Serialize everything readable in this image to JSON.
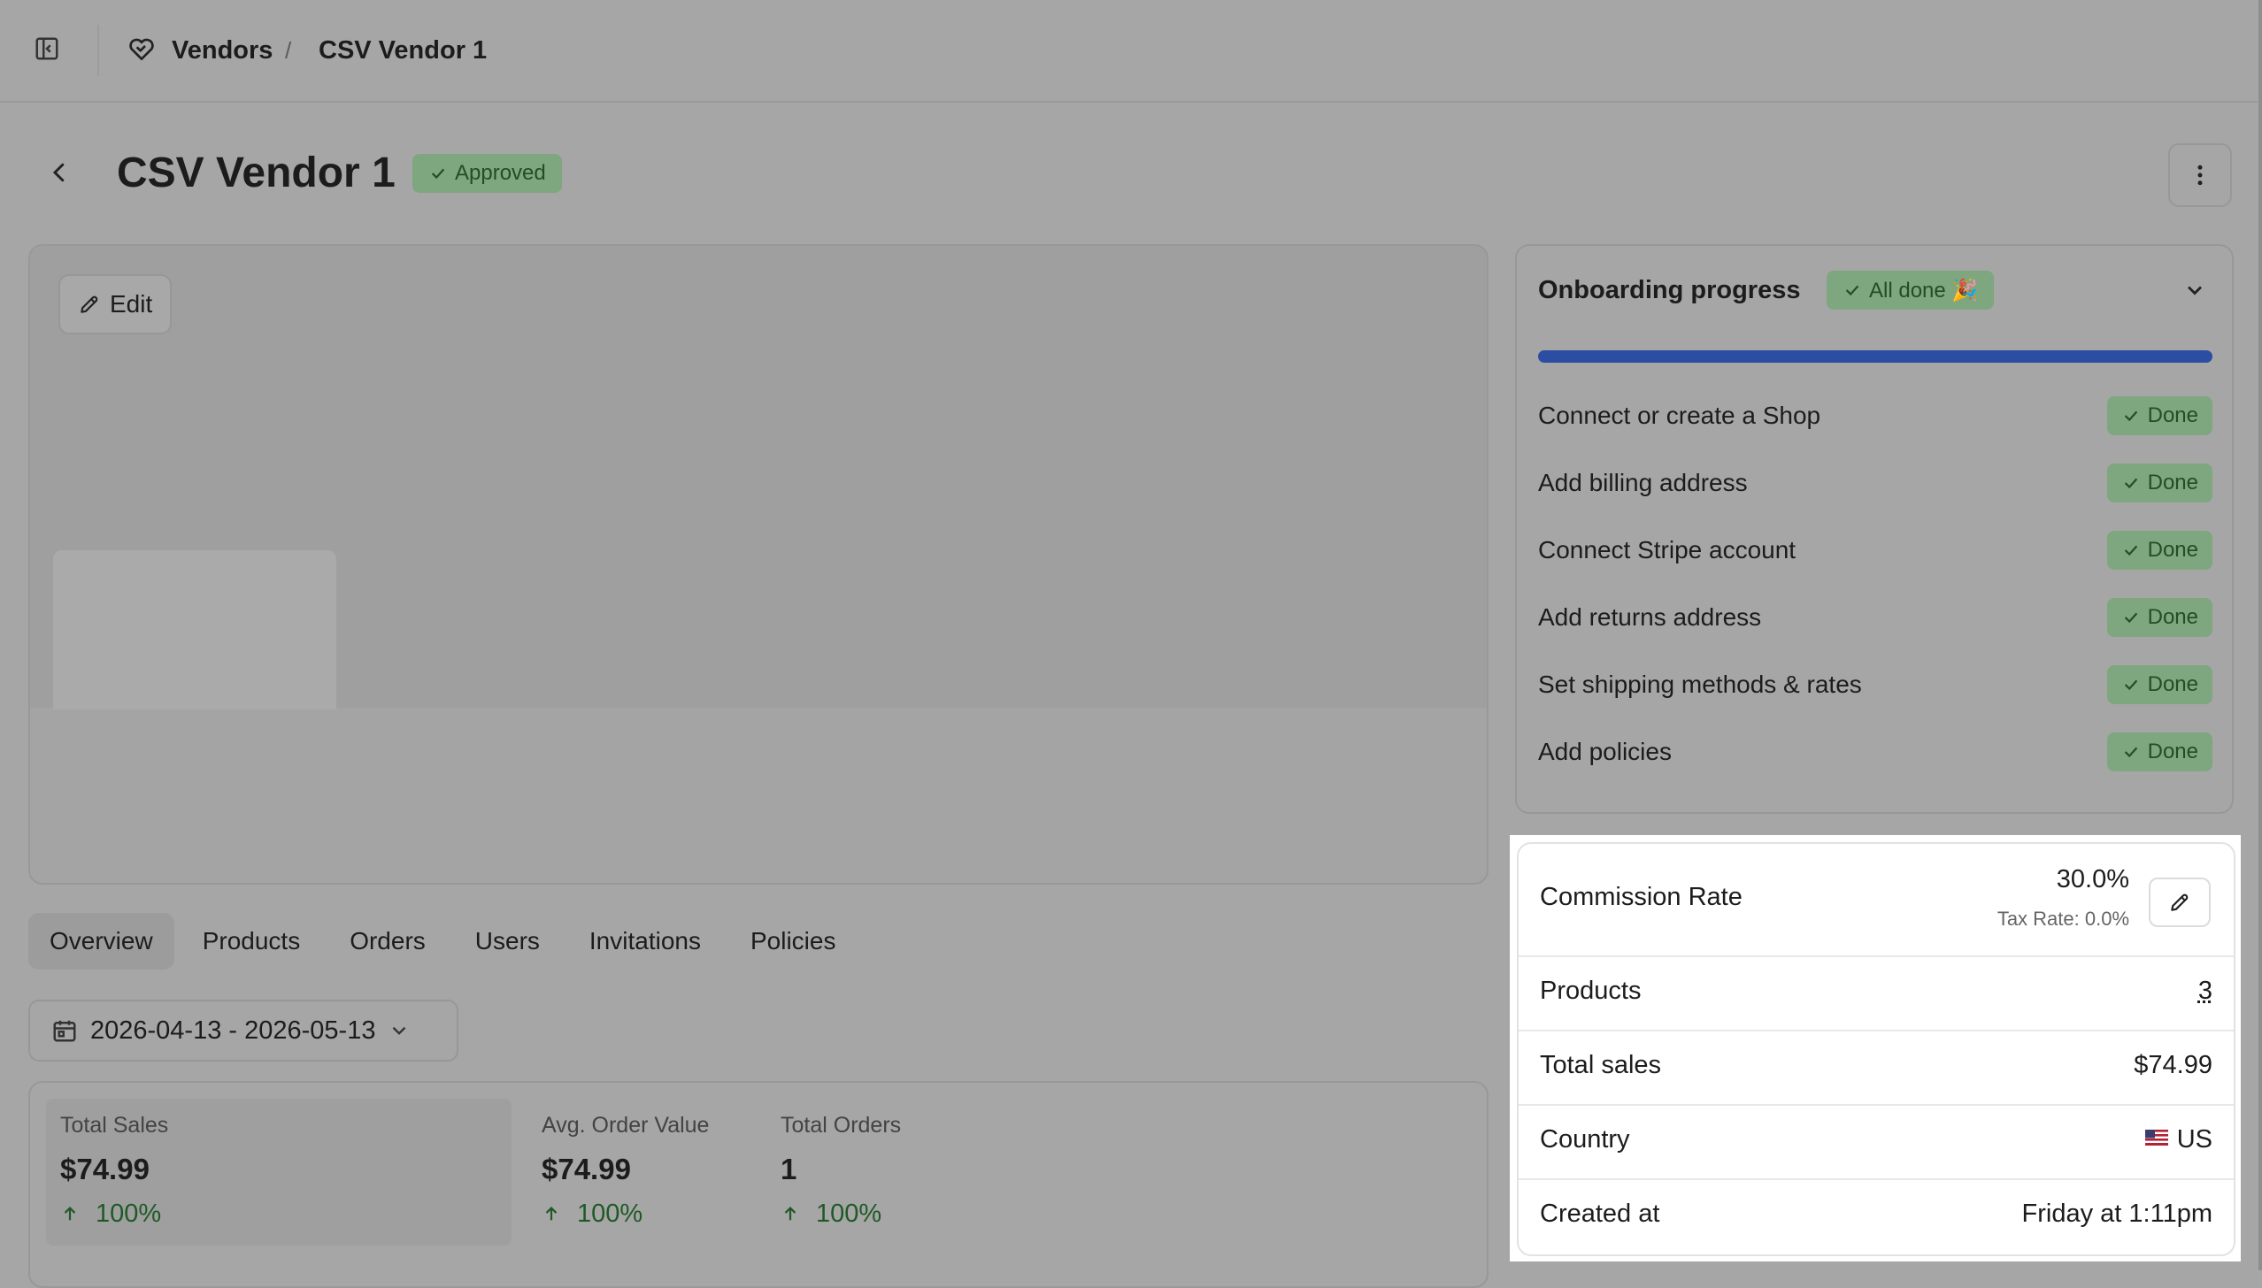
{
  "breadcrumb": {
    "root": "Vendors",
    "separator": "/",
    "current": "CSV Vendor 1"
  },
  "header": {
    "title": "CSV Vendor 1",
    "status": "Approved"
  },
  "banner": {
    "edit_label": "Edit"
  },
  "tabs": [
    "Overview",
    "Products",
    "Orders",
    "Users",
    "Invitations",
    "Policies"
  ],
  "active_tab": "Overview",
  "date_range": {
    "value": "2026-04-13 - 2026-05-13"
  },
  "stats": [
    {
      "label": "Total Sales",
      "value": "$74.99",
      "change": "100%"
    },
    {
      "label": "Avg. Order Value",
      "value": "$74.99",
      "change": "100%"
    },
    {
      "label": "Total Orders",
      "value": "1",
      "change": "100%"
    }
  ],
  "onboarding": {
    "title": "Onboarding progress",
    "status": "All done 🎉",
    "progress_percent": 100,
    "steps": [
      {
        "label": "Connect or create a Shop",
        "status": "Done"
      },
      {
        "label": "Add billing address",
        "status": "Done"
      },
      {
        "label": "Connect Stripe account",
        "status": "Done"
      },
      {
        "label": "Add returns address",
        "status": "Done"
      },
      {
        "label": "Set shipping methods & rates",
        "status": "Done"
      },
      {
        "label": "Add policies",
        "status": "Done"
      }
    ]
  },
  "info": {
    "commission": {
      "label": "Commission Rate",
      "value": "30.0%",
      "tax": "Tax Rate: 0.0%"
    },
    "products": {
      "label": "Products",
      "value": "3"
    },
    "total_sales": {
      "label": "Total sales",
      "value": "$74.99"
    },
    "country": {
      "label": "Country",
      "value": "US"
    },
    "created_at": {
      "label": "Created at",
      "value": "Friday at 1:11pm"
    }
  },
  "colors": {
    "accent": "#2c4ea2",
    "success_bg": "#7ea67f",
    "success_text": "#234d26"
  }
}
